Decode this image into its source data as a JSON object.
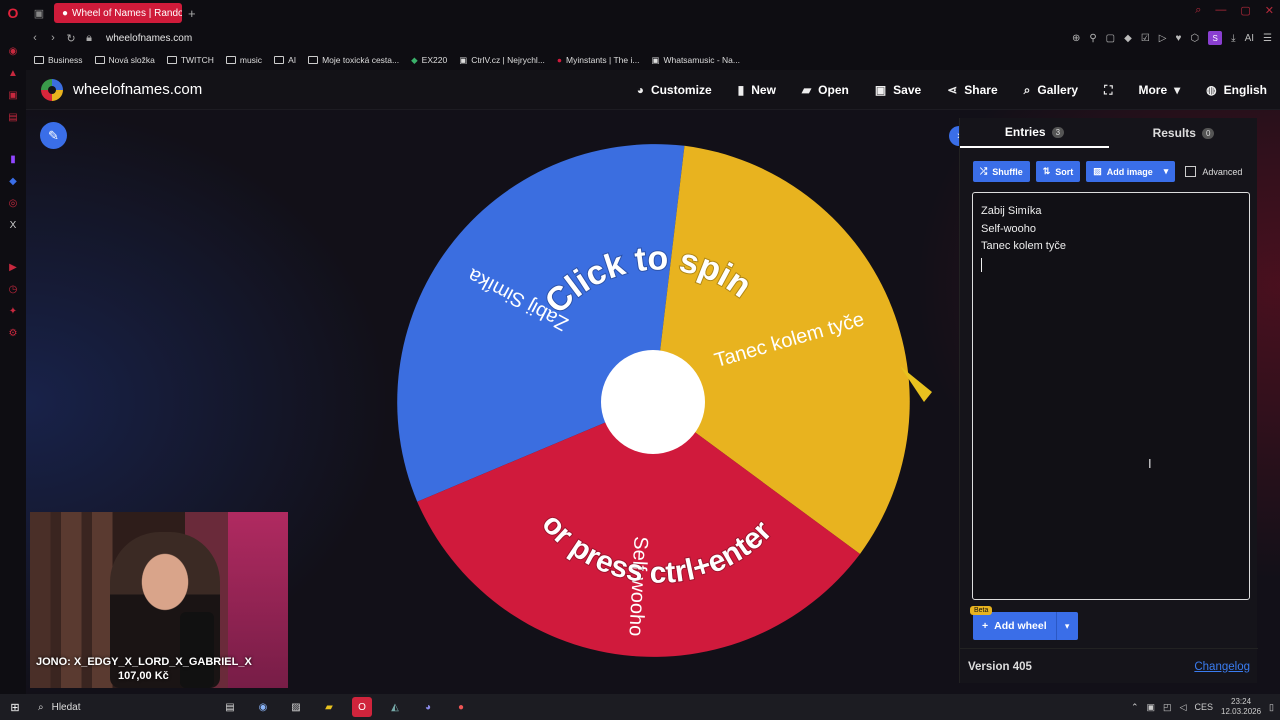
{
  "browser": {
    "tab_title": "Wheel of Names | Random",
    "url": "wheelofnames.com",
    "bookmarks": [
      "Business",
      "Nová složka",
      "TWITCH",
      "music",
      "AI",
      "Moje toxická cesta...",
      "EX220",
      "CtrlV.cz | Nejrychl...",
      "Myinstants | The i...",
      "Whatsamusic - Na..."
    ],
    "profile_letter": "S",
    "ai_label": "AI"
  },
  "site": {
    "name": "wheelofnames.com",
    "menu": [
      {
        "icon": "palette-icon",
        "label": "Customize"
      },
      {
        "icon": "file-icon",
        "label": "New"
      },
      {
        "icon": "folder-open-icon",
        "label": "Open"
      },
      {
        "icon": "save-icon",
        "label": "Save"
      },
      {
        "icon": "share-icon",
        "label": "Share"
      },
      {
        "icon": "search-icon",
        "label": "Gallery"
      },
      {
        "icon": "fullscreen-icon",
        "label": ""
      },
      {
        "icon": "caret-down-icon",
        "label": "More"
      },
      {
        "icon": "globe-icon",
        "label": "English"
      }
    ]
  },
  "wheel": {
    "cta_top": "Click to spin",
    "cta_bottom": "or press ctrl+enter",
    "segments": [
      {
        "label": "Zabij Simíka",
        "color": "#3b6ee0"
      },
      {
        "label": "Tanec kolem tyče",
        "color": "#e8b31f"
      },
      {
        "label": "Self-wooho",
        "color": "#d01a3c"
      }
    ]
  },
  "panel": {
    "tab_entries": "Entries",
    "entries_count": "3",
    "tab_results": "Results",
    "results_count": "0",
    "shuffle": "Shuffle",
    "sort": "Sort",
    "add_image": "Add image",
    "advanced": "Advanced",
    "entries": [
      "Zabij Simíka",
      "Self-wooho",
      "Tanec kolem tyče"
    ],
    "beta": "Beta",
    "add_wheel": "Add wheel",
    "version": "Version 405",
    "changelog": "Changelog"
  },
  "webcam": {
    "line1": "JONO: X_EDGY_X_LORD_X_GABRIEL_X",
    "line2": "107,00 Kč"
  },
  "taskbar": {
    "search": "Hledat",
    "lang": "CES",
    "time": "23:24",
    "date": "12.03.2026"
  }
}
